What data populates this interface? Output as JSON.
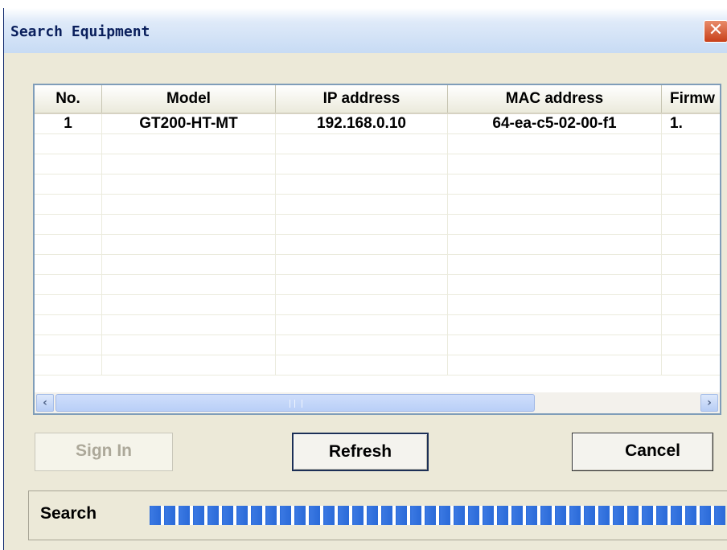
{
  "window": {
    "title": "Search Equipment",
    "close_glyph": "✕"
  },
  "list": {
    "columns": [
      "No.",
      "Model",
      "IP address",
      "MAC address",
      "Firmw"
    ],
    "rows": [
      [
        "1",
        "GT200-HT-MT",
        "192.168.0.10",
        "64-ea-c5-02-00-f1",
        "1."
      ]
    ]
  },
  "scrollbar": {
    "left_glyph": "‹",
    "right_glyph": "›"
  },
  "buttons": {
    "sign_in": "Sign In",
    "refresh": "Refresh",
    "cancel": "Cancel"
  },
  "status": {
    "label": "Search",
    "progress": 1.0
  },
  "colors": {
    "progress_blue": "#2a6ad8",
    "close_red": "#c8401a"
  }
}
